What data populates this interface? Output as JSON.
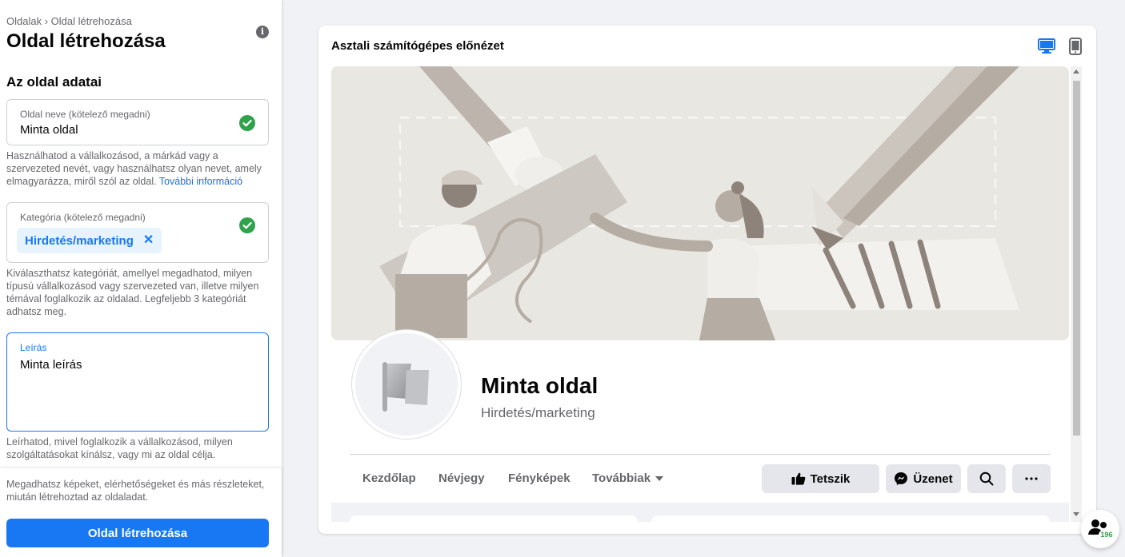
{
  "breadcrumb": "Oldalak › Oldal létrehozása",
  "page_title": "Oldal létrehozása",
  "section_title": "Az oldal adatai",
  "name_field": {
    "label": "Oldal neve (kötelező megadni)",
    "value": "Minta oldal",
    "helper": "Használhatod a vállalkozásod, a márkád vagy a szervezeted nevét, vagy használhatsz olyan nevet, amely elmagyarázza, miről szól az oldal.",
    "helper_link": "További információ"
  },
  "category_field": {
    "label": "Kategória (kötelező megadni)",
    "chip": "Hirdetés/marketing",
    "helper": "Kiválaszthatsz kategóriát, amellyel megadhatod, milyen típusú vállalkozásod vagy szervezeted van, illetve milyen témával foglalkozik az oldalad. Legfeljebb 3 kategóriát adhatsz meg."
  },
  "description_field": {
    "label": "Leírás",
    "value": "Minta leírás",
    "helper": "Leírhatod, mivel foglalkozik a vállalkozásod, milyen szolgáltatásokat kínálsz, vagy mi az oldal célja."
  },
  "footer": {
    "text": "Megadhatsz képeket, elérhetőségeket és más részleteket, miután létrehoztad az oldaladat.",
    "create_button": "Oldal létrehozása"
  },
  "preview": {
    "title": "Asztali számítógépes előnézet",
    "page_name": "Minta oldal",
    "page_category": "Hirdetés/marketing",
    "tabs": [
      "Kezdőlap",
      "Névjegy",
      "Fényképek",
      "Továbbiak"
    ],
    "like_button": "Tetszik",
    "message_button": "Üzenet"
  },
  "notification_count": "196",
  "colors": {
    "accent": "#1877f2",
    "success": "#31a24c",
    "muted": "#65676b"
  }
}
